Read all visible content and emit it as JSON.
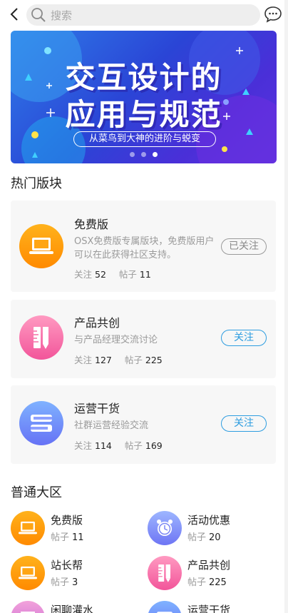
{
  "header": {
    "search_placeholder": "搜索"
  },
  "banner": {
    "title_line1": "交互设计的",
    "title_line2": "应用与规范",
    "subtitle": "从菜鸟到大神的进阶与蜕变",
    "active_slide": 3,
    "slide_count": 3
  },
  "hot_section": {
    "title": "热门版块",
    "stat_follow_label": "关注",
    "stat_post_label": "帖子",
    "cards": [
      {
        "name": "免费版",
        "desc": "OSX免费版专属版块，免费版用户可以在此获得社区支持。",
        "follows": "52",
        "posts": "11",
        "button": "已关注",
        "icon": "laptop-icon"
      },
      {
        "name": "产品共创",
        "desc": "与产品经理交流讨论",
        "follows": "127",
        "posts": "225",
        "button": "关注",
        "icon": "ruler-pencil-icon"
      },
      {
        "name": "运营干货",
        "desc": "社群运营经验交流",
        "follows": "114",
        "posts": "169",
        "button": "关注",
        "icon": "book-stack-icon"
      }
    ]
  },
  "normal_section": {
    "title": "普通大区",
    "post_label": "帖子",
    "items": [
      {
        "name": "免费版",
        "posts": "11",
        "icon": "laptop-icon"
      },
      {
        "name": "活动优惠",
        "posts": "20",
        "icon": "alarm-clock-icon"
      },
      {
        "name": "站长帮",
        "posts": "3",
        "icon": "laptop-icon"
      },
      {
        "name": "产品共创",
        "posts": "225",
        "icon": "ruler-pencil-icon"
      },
      {
        "name": "闲聊灌水",
        "posts": "",
        "icon": "chat-bubble-icon"
      },
      {
        "name": "运营干货",
        "posts": "",
        "icon": "book-stack-icon"
      }
    ]
  },
  "colors": {
    "accent": "#2e9de0",
    "muted_text": "#9a9a9a",
    "card_bg": "#f7f7f7"
  }
}
